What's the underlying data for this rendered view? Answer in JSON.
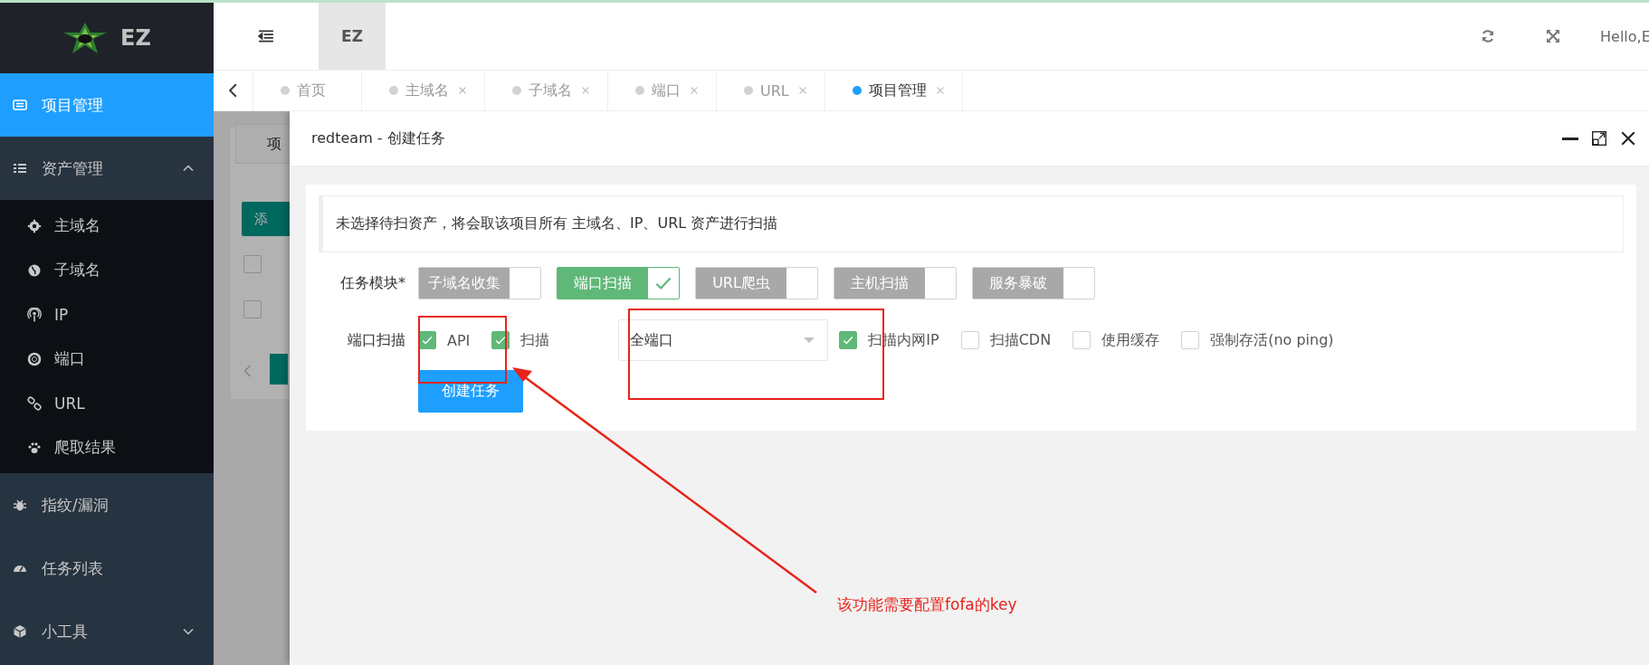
{
  "sidebar": {
    "logo_text": "EZ",
    "items": [
      {
        "label": "项目管理",
        "selected": true
      },
      {
        "label": "资产管理",
        "selected": false,
        "expanded": true,
        "children": [
          {
            "label": "主域名",
            "selected": false
          },
          {
            "label": "子域名",
            "selected": false
          },
          {
            "label": "IP",
            "selected": false
          },
          {
            "label": "端口",
            "selected": false
          },
          {
            "label": "URL",
            "selected": false
          },
          {
            "label": "爬取结果",
            "selected": false
          }
        ]
      },
      {
        "label": "指纹/漏洞",
        "selected": false
      },
      {
        "label": "任务列表",
        "selected": false
      },
      {
        "label": "小工具",
        "selected": false,
        "expanded": false
      }
    ]
  },
  "header": {
    "app_tab": "EZ",
    "greeting": "Hello,E"
  },
  "tabs": [
    {
      "label": "首页",
      "selected": false,
      "closable": false
    },
    {
      "label": "主域名",
      "selected": false,
      "closable": true
    },
    {
      "label": "子域名",
      "selected": false,
      "closable": true
    },
    {
      "label": "端口",
      "selected": false,
      "closable": true
    },
    {
      "label": "URL",
      "selected": false,
      "closable": true
    },
    {
      "label": "项目管理",
      "selected": true,
      "closable": true
    }
  ],
  "background_page": {
    "tab_fragment": "项",
    "button_fragment": "添",
    "checkboxes": [
      {
        "checked": false
      },
      {
        "checked": false
      }
    ]
  },
  "dialog": {
    "title": "redteam - 创建任务",
    "notice": "未选择待扫资产，将会取该项目所有 主域名、IP、URL 资产进行扫描",
    "modules_label": "任务模块*",
    "modules": [
      {
        "label": "子域名收集",
        "on": false
      },
      {
        "label": "端口扫描",
        "on": true
      },
      {
        "label": "URL爬虫",
        "on": false
      },
      {
        "label": "主机扫描",
        "on": false
      },
      {
        "label": "服务暴破",
        "on": false
      }
    ],
    "port_label": "端口扫描",
    "port_options": [
      {
        "label": "API",
        "checked": true
      },
      {
        "label": "扫描",
        "checked": true
      }
    ],
    "port_range": "全端口",
    "options": [
      {
        "label": "扫描内网IP",
        "checked": true
      },
      {
        "label": "扫描CDN",
        "checked": false
      },
      {
        "label": "使用缓存",
        "checked": false
      },
      {
        "label": "强制存活(no ping)",
        "checked": false
      }
    ],
    "submit": "创建任务"
  },
  "annotation": {
    "text": "该功能需要配置fofa的key"
  }
}
